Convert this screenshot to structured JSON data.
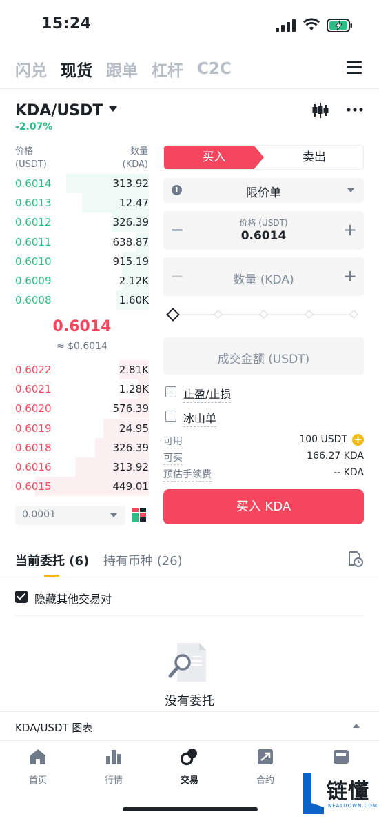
{
  "status_bar": {
    "time": "15:24"
  },
  "top_tabs": [
    "闪兑",
    "现货",
    "跟单",
    "杠杆",
    "C2C"
  ],
  "active_top_tab": "现货",
  "pair": {
    "symbol": "KDA/USDT",
    "change": "-2.07%"
  },
  "orderbook": {
    "price_header": "价格",
    "price_unit": "(USDT)",
    "qty_header": "数量",
    "qty_unit": "(KDA)",
    "asks": [
      {
        "price": "0.6022",
        "qty": "2.81K",
        "depth": 0.62
      },
      {
        "price": "0.6021",
        "qty": "1.28K",
        "depth": 0.5
      },
      {
        "price": "0.6020",
        "qty": "576.39",
        "depth": 0.28
      },
      {
        "price": "0.6019",
        "qty": "24.95",
        "depth": 0.1
      },
      {
        "price": "0.6018",
        "qty": "326.39",
        "depth": 0.2
      },
      {
        "price": "0.6016",
        "qty": "313.92",
        "depth": 0.2
      },
      {
        "price": "0.6015",
        "qty": "449.01",
        "depth": 0.25
      }
    ],
    "last_price": "0.6014",
    "last_price_usd": "≈ $0.6014",
    "bids": [
      {
        "price": "0.6014",
        "qty": "313.92",
        "depth": 0.22
      },
      {
        "price": "0.6013",
        "qty": "12.47",
        "depth": 0.08
      },
      {
        "price": "0.6012",
        "qty": "326.39",
        "depth": 0.22
      },
      {
        "price": "0.6011",
        "qty": "638.87",
        "depth": 0.34
      },
      {
        "price": "0.6010",
        "qty": "915.19",
        "depth": 0.4
      },
      {
        "price": "0.6009",
        "qty": "2.12K",
        "depth": 0.55
      },
      {
        "price": "0.6008",
        "qty": "1.60K",
        "depth": 0.85
      }
    ],
    "depth_select": "0.0001"
  },
  "trade_form": {
    "buy_label": "买入",
    "sell_label": "卖出",
    "order_type": "限价单",
    "price_caption": "价格 (USDT)",
    "price_value": "0.6014",
    "qty_placeholder": "数量 (KDA)",
    "total_placeholder": "成交金额 (USDT)",
    "tp_sl_label": "止盈/止损",
    "iceberg_label": "冰山单",
    "available_label": "可用",
    "available_value": "100 USDT",
    "can_buy_label": "可买",
    "can_buy_value": "166.27 KDA",
    "fee_label": "预估手续费",
    "fee_value": "-- KDA",
    "submit_label": "买入 KDA",
    "slider_fraction": 0
  },
  "orders": {
    "open_orders_tab": "当前委托 (6)",
    "holdings_tab": "持有币种 (26)",
    "hide_others_label": "隐藏其他交易对",
    "empty_text": "没有委托",
    "chart_label": "KDA/USDT 图表"
  },
  "bottom_nav": [
    {
      "label": "首页",
      "icon": "home-icon"
    },
    {
      "label": "行情",
      "icon": "markets-icon"
    },
    {
      "label": "交易",
      "icon": "trade-icon"
    },
    {
      "label": "合约",
      "icon": "futures-icon"
    },
    {
      "label": "",
      "icon": "wallet-icon"
    }
  ],
  "active_nav": "交易",
  "watermark": {
    "brand": "链懂",
    "sub": "NEATDOWN.COM"
  },
  "colors": {
    "buy": "#f6465d",
    "bid_green": "#2ebd85",
    "accent": "#f0b90b",
    "text": "#1e2329",
    "muted": "#707a8a"
  }
}
